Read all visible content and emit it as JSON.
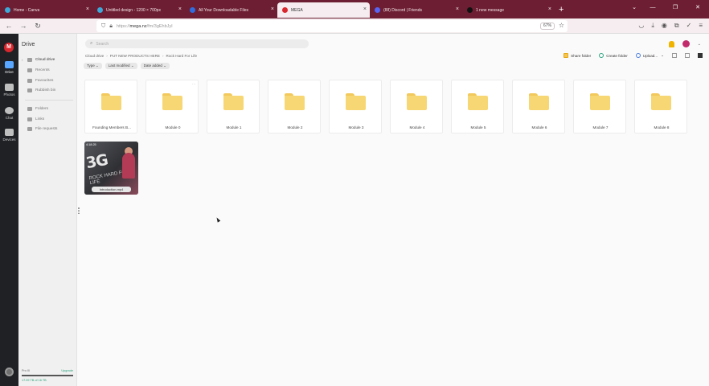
{
  "browser": {
    "tabs": [
      {
        "label": "Home - Canva",
        "fav": "canva",
        "color": "#3ea8d8",
        "active": false
      },
      {
        "label": "Untitled design - 1200 × 700px",
        "fav": "canva",
        "color": "#3ea8d8",
        "active": false
      },
      {
        "label": "All Your Downloadable Files",
        "fav": "XC",
        "color": "#2f6de0",
        "active": false
      },
      {
        "label": "MEGA",
        "fav": "M",
        "color": "#d9272e",
        "active": true
      },
      {
        "label": "(88) Discord | Friends",
        "fav": "discord",
        "color": "#5865f2",
        "active": false
      },
      {
        "label": "1 new message",
        "fav": "A",
        "color": "#111111",
        "active": false
      }
    ],
    "url_prefix": "https://",
    "url_host": "mega.nz",
    "url_path": "/fm/3gEhbJyI",
    "zoom": "67%"
  },
  "rail": {
    "items": [
      {
        "label": "Drive",
        "active": true
      },
      {
        "label": "Photos",
        "active": false
      },
      {
        "label": "Chat",
        "active": false
      },
      {
        "label": "Devices",
        "active": false
      }
    ]
  },
  "sidebar": {
    "title": "Drive",
    "items": [
      {
        "label": "Cloud drive",
        "active": true
      },
      {
        "label": "Recents",
        "active": false
      },
      {
        "label": "Favourites",
        "active": false
      },
      {
        "label": "Rubbish bin",
        "active": false
      }
    ],
    "items2": [
      {
        "label": "Folders"
      },
      {
        "label": "Links"
      },
      {
        "label": "File requests"
      }
    ],
    "storage": {
      "plan": "Pro III",
      "upgrade": "Upgrade",
      "used_text": "17.09 TB of 16 TB",
      "used_fraction": 1.0
    }
  },
  "main": {
    "search_placeholder": "Search",
    "breadcrumb": [
      "Cloud drive",
      "PUT NEW PRODUCTS HERE",
      "Rock Hard For Life"
    ],
    "actions": {
      "share": "Share folder",
      "create": "Create folder",
      "upload": "Upload..."
    },
    "filters": [
      "Type",
      "Last modified",
      "Date added"
    ],
    "folders": [
      "Founding Members B...",
      "Module 0",
      "Module 1",
      "Module 2",
      "Module 3",
      "Module 4",
      "Module 5",
      "Module 6",
      "Module 7",
      "Module 8"
    ],
    "video": {
      "duration": "4:18:25",
      "title_text": "3G",
      "sub_text": "ROCK HARD FOR LIFE",
      "name": "Introduction.mp4"
    }
  }
}
